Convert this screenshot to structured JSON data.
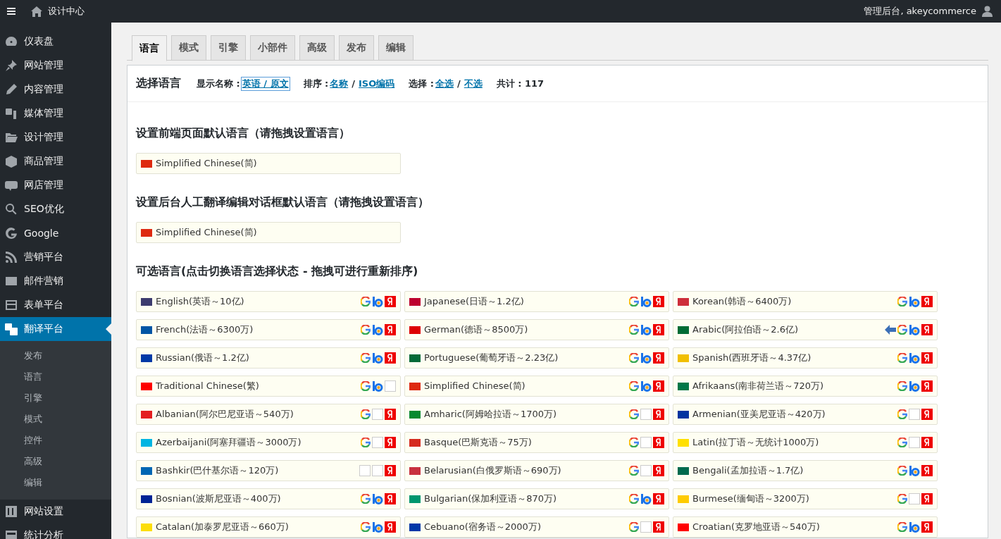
{
  "topbar": {
    "site": "设计中心",
    "user": "管理后台, akeycommerce"
  },
  "sidebar": [
    {
      "label": "仪表盘",
      "selected": false
    },
    {
      "label": "网站管理",
      "selected": false
    },
    {
      "label": "内容管理",
      "selected": false
    },
    {
      "label": "媒体管理",
      "selected": false
    },
    {
      "label": "设计管理",
      "selected": false
    },
    {
      "label": "商品管理",
      "selected": false
    },
    {
      "label": "网店管理",
      "selected": false
    },
    {
      "label": "SEO优化",
      "selected": false
    },
    {
      "label": "Google",
      "selected": false
    },
    {
      "label": "营销平台",
      "selected": false
    },
    {
      "label": "邮件营销",
      "selected": false
    },
    {
      "label": "表单平台",
      "selected": false
    },
    {
      "label": "翻译平台",
      "selected": true,
      "children": [
        {
          "label": "发布",
          "selected": false
        },
        {
          "label": "语言",
          "selected": false
        },
        {
          "label": "引擎",
          "selected": false
        },
        {
          "label": "模式",
          "selected": false
        },
        {
          "label": "控件",
          "selected": false
        },
        {
          "label": "高级",
          "selected": false
        },
        {
          "label": "编辑",
          "selected": false
        }
      ]
    },
    {
      "label": "网站设置",
      "selected": false
    },
    {
      "label": "统计分析",
      "selected": false
    }
  ],
  "tabs": [
    {
      "label": "语言",
      "selected": true
    },
    {
      "label": "模式",
      "selected": false
    },
    {
      "label": "引擎",
      "selected": false
    },
    {
      "label": "小部件",
      "selected": false
    },
    {
      "label": "高级",
      "selected": false
    },
    {
      "label": "发布",
      "selected": false
    },
    {
      "label": "编辑",
      "selected": false
    }
  ],
  "header": {
    "title": "选择语言",
    "display": {
      "label": "显示名称 :",
      "link": "英语 / 原文"
    },
    "sort": {
      "label": "排序 :",
      "links": [
        "名称",
        "ISO编码"
      ],
      "separator": "/"
    },
    "select": {
      "label": "选择 :",
      "links": [
        "全选",
        "不选"
      ],
      "separator": "/"
    },
    "total": "共计 : 117"
  },
  "frontend_default": {
    "title": "设置前端页面默认语言（请拖拽设置语言）",
    "language": {
      "name": "Simplified Chinese(简)",
      "color": "#de2910"
    }
  },
  "backend_default": {
    "title": "设置后台人工翻译编辑对话框默认语言（请拖拽设置语言）",
    "language": {
      "name": "Simplified Chinese(简)",
      "color": "#de2910"
    }
  },
  "available": {
    "title": "可选语言(点击切换语言选择状态 - 拖拽可进行重新排序)",
    "languages": [
      {
        "name": "English(英语～10亿)",
        "color": "#3c3b6e",
        "rtl": false,
        "google": true,
        "bing": true,
        "yandex": true
      },
      {
        "name": "Japanese(日语～1.2亿)",
        "color": "#bc002d",
        "rtl": false,
        "google": true,
        "bing": true,
        "yandex": true
      },
      {
        "name": "Korean(韩语～6400万)",
        "color": "#cd2e3a",
        "rtl": false,
        "google": true,
        "bing": true,
        "yandex": true
      },
      {
        "name": "French(法语～6300万)",
        "color": "#0055a4",
        "rtl": false,
        "google": true,
        "bing": true,
        "yandex": true
      },
      {
        "name": "German(德语～8500万)",
        "color": "#dd0000",
        "rtl": false,
        "google": true,
        "bing": true,
        "yandex": true
      },
      {
        "name": "Arabic(阿拉伯语～2.6亿)",
        "color": "#006c35",
        "rtl": true,
        "google": true,
        "bing": true,
        "yandex": true
      },
      {
        "name": "Russian(俄语～1.2亿)",
        "color": "#0039a6",
        "rtl": false,
        "google": true,
        "bing": true,
        "yandex": true
      },
      {
        "name": "Portuguese(葡萄牙语～2.23亿)",
        "color": "#046a38",
        "rtl": false,
        "google": true,
        "bing": true,
        "yandex": true
      },
      {
        "name": "Spanish(西班牙语～4.37亿)",
        "color": "#f1bf00",
        "rtl": false,
        "google": true,
        "bing": true,
        "yandex": true
      },
      {
        "name": "Traditional Chinese(繁)",
        "color": "#fe0000",
        "rtl": false,
        "google": true,
        "bing": true,
        "yandex": false
      },
      {
        "name": "Simplified Chinese(简)",
        "color": "#de2910",
        "rtl": false,
        "google": true,
        "bing": true,
        "yandex": true
      },
      {
        "name": "Afrikaans(南非荷兰语～720万)",
        "color": "#007749",
        "rtl": false,
        "google": true,
        "bing": true,
        "yandex": true
      },
      {
        "name": "Albanian(阿尔巴尼亚语～540万)",
        "color": "#e41e20",
        "rtl": false,
        "google": true,
        "bing": false,
        "yandex": true
      },
      {
        "name": "Amharic(阿姆哈拉语～1700万)",
        "color": "#078930",
        "rtl": false,
        "google": true,
        "bing": false,
        "yandex": true
      },
      {
        "name": "Armenian(亚美尼亚语～420万)",
        "color": "#0033a0",
        "rtl": false,
        "google": true,
        "bing": false,
        "yandex": true
      },
      {
        "name": "Azerbaijani(阿塞拜疆语～3000万)",
        "color": "#00b5e2",
        "rtl": false,
        "google": true,
        "bing": false,
        "yandex": true
      },
      {
        "name": "Basque(巴斯克语～75万)",
        "color": "#d52b1e",
        "rtl": false,
        "google": true,
        "bing": false,
        "yandex": true
      },
      {
        "name": "Latin(拉丁语～无统计1000万)",
        "color": "#ffe000",
        "rtl": false,
        "google": true,
        "bing": false,
        "yandex": true
      },
      {
        "name": "Bashkir(巴什基尔语～120万)",
        "color": "#0066b3",
        "rtl": false,
        "google": false,
        "bing": false,
        "yandex": true
      },
      {
        "name": "Belarusian(白俄罗斯语～690万)",
        "color": "#c8313e",
        "rtl": false,
        "google": true,
        "bing": false,
        "yandex": true
      },
      {
        "name": "Bengali(孟加拉语～1.7亿)",
        "color": "#006a4e",
        "rtl": false,
        "google": true,
        "bing": true,
        "yandex": true
      },
      {
        "name": "Bosnian(波斯尼亚语～400万)",
        "color": "#002395",
        "rtl": false,
        "google": true,
        "bing": true,
        "yandex": true
      },
      {
        "name": "Bulgarian(保加利亚语～870万)",
        "color": "#00966e",
        "rtl": false,
        "google": true,
        "bing": true,
        "yandex": true
      },
      {
        "name": "Burmese(缅甸语～3200万)",
        "color": "#fecb00",
        "rtl": false,
        "google": true,
        "bing": false,
        "yandex": true
      },
      {
        "name": "Catalan(加泰罗尼亚语～660万)",
        "color": "#fcdd09",
        "rtl": false,
        "google": true,
        "bing": true,
        "yandex": true
      },
      {
        "name": "Cebuano(宿务语～2000万)",
        "color": "#0038a8",
        "rtl": false,
        "google": true,
        "bing": false,
        "yandex": true
      },
      {
        "name": "Croatian(克罗地亚语～540万)",
        "color": "#ff0000",
        "rtl": false,
        "google": true,
        "bing": true,
        "yandex": true
      }
    ]
  }
}
